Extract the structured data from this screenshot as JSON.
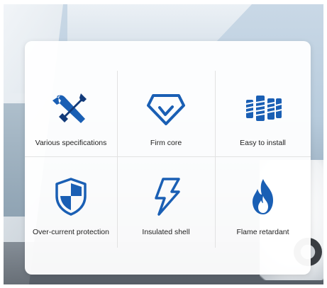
{
  "colors": {
    "icon_blue": "#1a5fb4",
    "icon_dark": "#123b7a"
  },
  "features": [
    {
      "label": "Various specifications",
      "icon": "wrench-screwdriver-icon"
    },
    {
      "label": "Firm core",
      "icon": "gem-check-icon"
    },
    {
      "label": "Easy to install",
      "icon": "bolts-screws-icon"
    },
    {
      "label": "Over-current protection",
      "icon": "shield-icon"
    },
    {
      "label": "Insulated shell",
      "icon": "lightning-icon"
    },
    {
      "label": "Flame retardant",
      "icon": "flame-icon"
    }
  ]
}
